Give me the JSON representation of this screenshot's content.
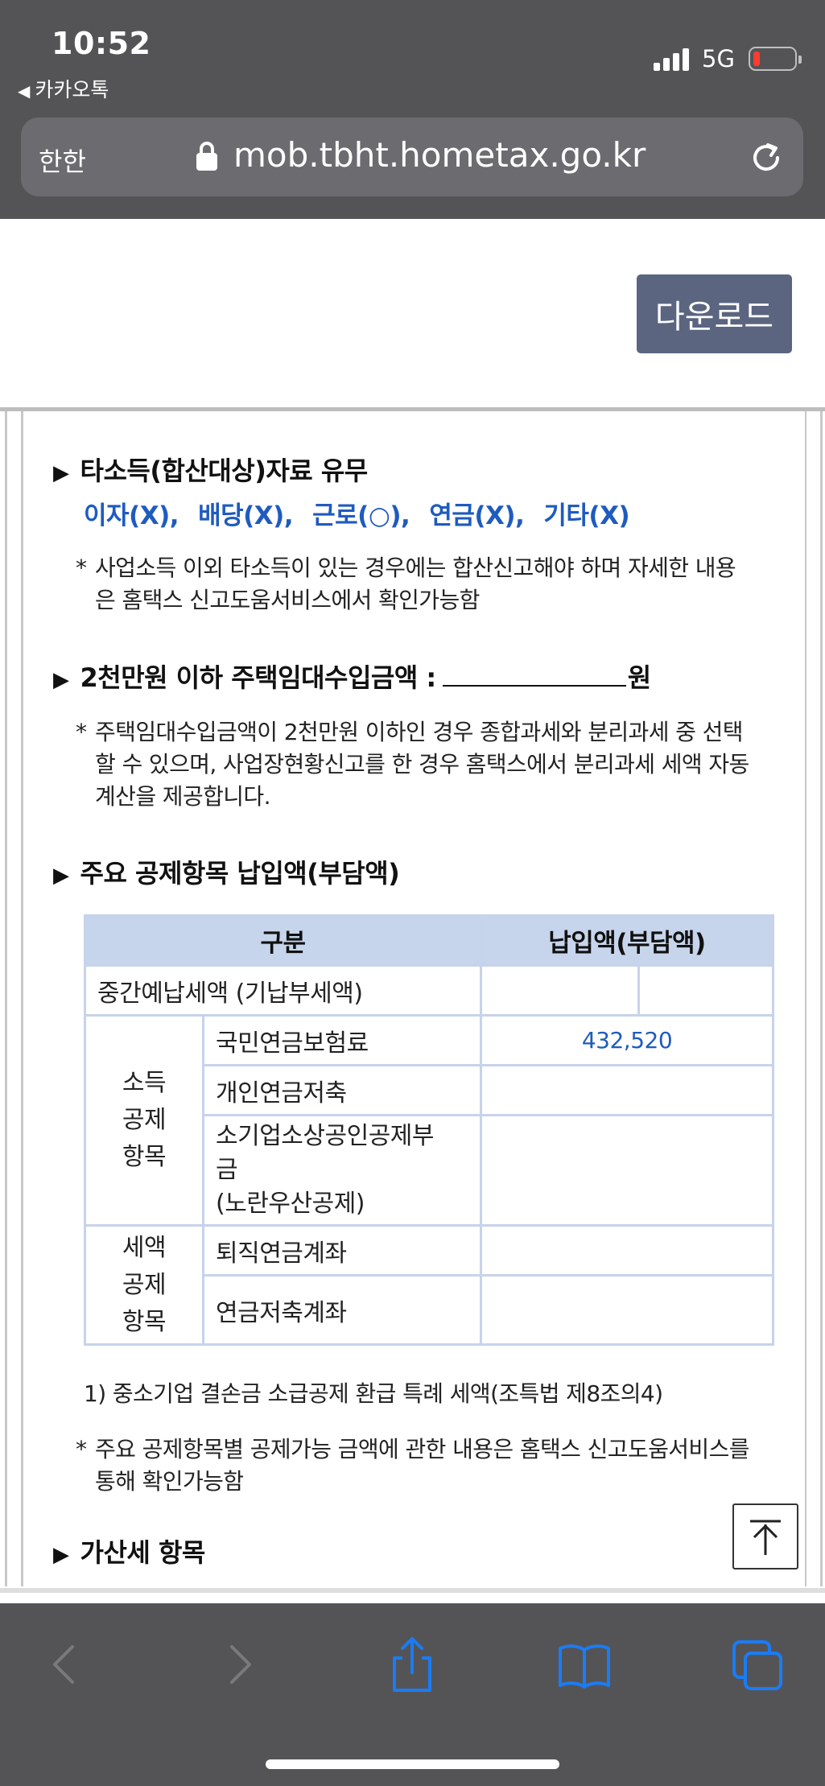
{
  "status_bar": {
    "time": "10:52",
    "back_app": "카카오톡",
    "network": "5G"
  },
  "url_bar": {
    "aa_label": "한한",
    "url": "mob.tbht.hometax.go.kr"
  },
  "page": {
    "download_label": "다운로드",
    "section1": {
      "title": "타소득(합산대상)자료 유무",
      "items": [
        "이자(X),",
        "배당(X),",
        "근로(○),",
        "연금(X),",
        "기타(X)"
      ],
      "note_star": "*",
      "note_line1": "사업소득 이외 타소득이 있는 경우에는 합산신고해야 하며 자세한 내용",
      "note_line2": "은 홈택스 신고도움서비스에서 확인가능함"
    },
    "section2": {
      "title": "2천만원 이하 주택임대수입금액 :",
      "unit": "원",
      "note_star": "*",
      "note_line1": "주택임대수입금액이 2천만원 이하인 경우 종합과세와 분리과세 중 선택",
      "note_line2": "할 수 있으며, 사업장현황신고를 한 경우 홈택스에서 분리과세 세액 자동",
      "note_line3": "계산을 제공합니다."
    },
    "section3": {
      "title": "주요 공제항목 납입액(부담액)",
      "table": {
        "header_category": "구분",
        "header_amount": "납입액(부담액)",
        "row_prepaid": "중간예납세액 (기납부세액)",
        "income_group": [
          "소득",
          "공제",
          "항목"
        ],
        "income_items": [
          "국민연금보험료",
          "개인연금저축"
        ],
        "income_item3_lines": [
          "소기업소상공인공제부",
          "금",
          "(노란우산공제)"
        ],
        "pension_value": "432,520",
        "tax_group": [
          "세액",
          "공제",
          "항목"
        ],
        "tax_items": [
          "퇴직연금계좌",
          "연금저축계좌"
        ]
      },
      "footnote": "1) 중소기업 결손금 소급공제 환급 특례 세액(조특법 제8조의4)",
      "note_star": "*",
      "note_line1": "주요 공제항목별 공제가능 금액에 관한 내용은 홈택스 신고도움서비스를",
      "note_line2": "통해 확인가능함"
    },
    "section4": {
      "title": "가산세 항목"
    }
  },
  "icons": {
    "heading_arrow": "▶",
    "back_triangle": "◀"
  },
  "colors": {
    "accent_blue": "#1f5bbf",
    "table_header_bg": "#c7d5ec",
    "download_button_bg": "#5b6580",
    "browser_chrome": "#545456"
  }
}
